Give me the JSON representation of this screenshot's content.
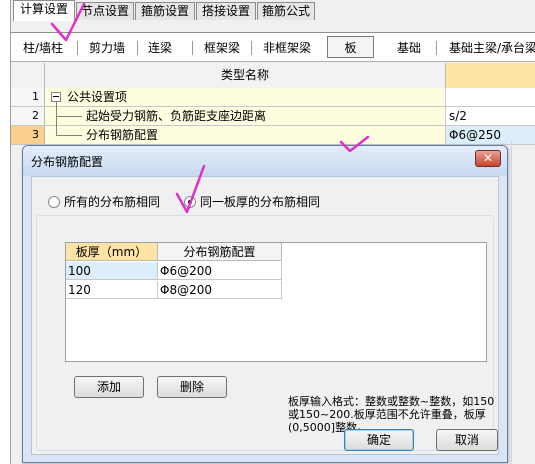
{
  "main_tabs": [
    {
      "label": "计算设置",
      "active": true
    },
    {
      "label": "节点设置",
      "active": false
    },
    {
      "label": "箍筋设置",
      "active": false
    },
    {
      "label": "搭接设置",
      "active": false
    },
    {
      "label": "箍筋公式",
      "active": false
    }
  ],
  "sub_tabs": [
    {
      "label": "柱/墙柱",
      "boxed": false
    },
    {
      "label": "剪力墙",
      "boxed": false
    },
    {
      "label": "连梁",
      "boxed": false
    },
    {
      "label": "框架梁",
      "boxed": false
    },
    {
      "label": "非框架梁",
      "boxed": false
    },
    {
      "label": "板",
      "boxed": true
    },
    {
      "label": "基础",
      "boxed": false
    },
    {
      "label": "基础主梁/承台梁",
      "boxed": false
    }
  ],
  "grid": {
    "header": "类型名称",
    "rows": [
      {
        "num": "1",
        "name": "公共设置项",
        "value": ""
      },
      {
        "num": "2",
        "name": "起始受力钢筋、负筋距支座边距离",
        "value": "s/2"
      },
      {
        "num": "3",
        "name": "分布钢筋配置",
        "value": "Φ6@250"
      }
    ]
  },
  "dialog": {
    "title": "分布钢筋配置",
    "close_glyph": "✕",
    "radio_all_label": "所有的分布筋相同",
    "radio_same_label": "同一板厚的分布筋相同",
    "table": {
      "headers": [
        "板厚（mm）",
        "分布钢筋配置"
      ],
      "rows": [
        {
          "thickness": "100",
          "config": "Φ6@200"
        },
        {
          "thickness": "120",
          "config": "Φ8@200"
        }
      ]
    },
    "add_label": "添加",
    "delete_label": "删除",
    "hint_line1": "板厚输入格式：整数或整数~整数，如150",
    "hint_line2": "或150~200.板厚范围不允许重叠，板厚",
    "hint_line3": "(0,5000]整数。",
    "ok_label": "确定",
    "cancel_label": "取消"
  },
  "colors": {
    "annotation": "#e02fc8",
    "header_accent": "#fde4a6",
    "selected_row": "#fbcf8c"
  }
}
